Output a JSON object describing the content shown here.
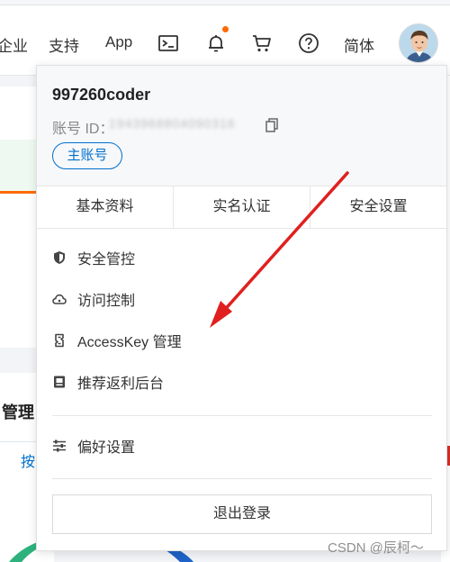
{
  "nav": {
    "partial_item": "企业",
    "support": "支持",
    "app": "App",
    "language": "简体"
  },
  "icons": {
    "terminal": "terminal-icon",
    "bell": "bell-icon",
    "cart": "cart-icon",
    "help": "question-icon",
    "avatar": "avatar"
  },
  "background": {
    "heading": "管理",
    "tab": "按"
  },
  "account": {
    "username": "997260coder",
    "id_label": "账号 ID：",
    "id_value": "1943968804090316",
    "main_badge": "主账号"
  },
  "tabs": [
    {
      "label": "基本资料"
    },
    {
      "label": "实名认证"
    },
    {
      "label": "安全设置"
    }
  ],
  "menu": [
    {
      "label": "安全管控",
      "icon": "shield-icon"
    },
    {
      "label": "访问控制",
      "icon": "cloud-icon"
    },
    {
      "label": "AccessKey 管理",
      "icon": "key-icon"
    },
    {
      "label": "推荐返利后台",
      "icon": "rebate-icon"
    }
  ],
  "preferences": {
    "label": "偏好设置",
    "icon": "sliders-icon"
  },
  "logout": {
    "label": "退出登录"
  },
  "watermark": "CSDN @辰柯～",
  "colors": {
    "accent_blue": "#0070cc",
    "notification_orange": "#ff6a00",
    "annotation_red": "#e02020"
  }
}
